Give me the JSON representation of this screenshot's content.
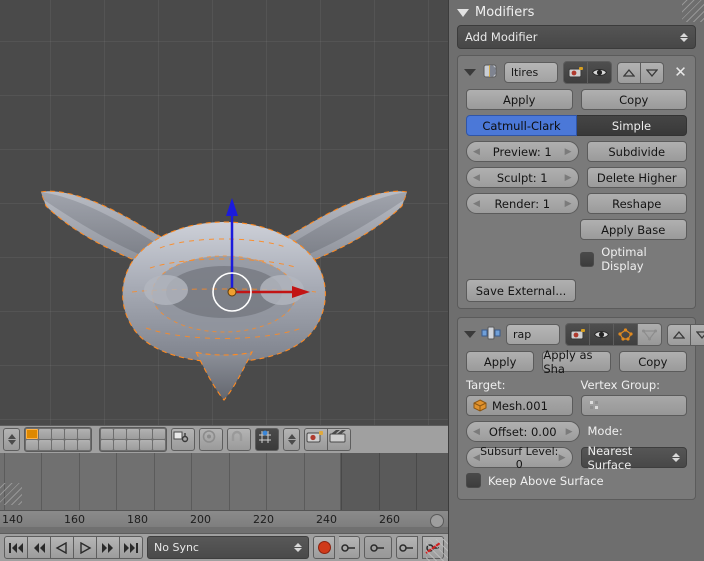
{
  "viewport": {
    "name": "3d-viewport",
    "background_color": "#4a4a4a",
    "object_selection_color": "#ff8a21",
    "manipulator": {
      "z_axis_color": "#1b1bdc",
      "x_axis_color": "#c21414",
      "origin_color": "#f0a030"
    },
    "header": {
      "layers_label": "layers",
      "active_layer": 1,
      "snap_label": "snap",
      "proportional_label": "proportional-edit"
    }
  },
  "timeline": {
    "ruler_ticks": [
      "140",
      "160",
      "180",
      "200",
      "220",
      "240",
      "260"
    ],
    "tick_positions": [
      4,
      79,
      154,
      229,
      304,
      379,
      448
    ],
    "minor_tick_positions": [
      41,
      116,
      191,
      266,
      341,
      416
    ],
    "out_of_range_start": 340,
    "playback": {
      "jump_start_label": "|<<",
      "prev_key_label": "<<",
      "play_reverse_label": "<",
      "play_label": ">",
      "next_key_label": ">>",
      "jump_end_label": ">>|"
    },
    "sync_mode": "No Sync",
    "record_label": "auto-keying",
    "keying_set_value": ""
  },
  "properties": {
    "panel_title": "Modifiers",
    "add_modifier_label": "Add Modifier",
    "modifiers": [
      {
        "type": "multires",
        "name": "ltires",
        "icon": "multires-icon",
        "toggles": [
          {
            "name": "render-toggle-icon",
            "glyph": "camera",
            "active": true
          },
          {
            "name": "realtime-toggle-icon",
            "glyph": "eye",
            "active": true
          }
        ],
        "move_up_label": "▲",
        "move_down_label": "▼",
        "close_label": "✕",
        "buttons": {
          "apply": "Apply",
          "copy": "Copy"
        },
        "subdivision_types": [
          {
            "label": "Catmull-Clark",
            "selected": true
          },
          {
            "label": "Simple",
            "selected": false
          }
        ],
        "levels": [
          {
            "label": "Preview: 1"
          },
          {
            "label": "Sculpt: 1"
          },
          {
            "label": "Render: 1"
          }
        ],
        "actions": [
          "Subdivide",
          "Delete Higher",
          "Reshape",
          "Apply Base"
        ],
        "optimal_display": {
          "label": "Optimal Display",
          "checked": false
        },
        "save_external": "Save External..."
      },
      {
        "type": "shrinkwrap",
        "name": "rap",
        "icon": "shrinkwrap-icon",
        "toggles": [
          {
            "name": "render-toggle-icon",
            "glyph": "camera",
            "active": true
          },
          {
            "name": "realtime-toggle-icon",
            "glyph": "eye",
            "active": true
          },
          {
            "name": "editmode-toggle-icon",
            "glyph": "edit-mode",
            "active": true
          },
          {
            "name": "oncage-toggle-icon",
            "glyph": "cage",
            "active": false
          }
        ],
        "buttons": {
          "apply": "Apply",
          "apply_as_shape": "Apply as Sha",
          "copy": "Copy"
        },
        "target_label": "Target:",
        "target_value": "Mesh.001",
        "vertex_group_label": "Vertex Group:",
        "vertex_group_value": "",
        "offset_label": "Offset: 0.00",
        "subsurf_label": "Subsurf Level: 0",
        "mode_label": "Mode:",
        "mode_value": "Nearest Surface",
        "keep_above_surface": {
          "label": "Keep Above Surface",
          "checked": false
        }
      }
    ]
  }
}
